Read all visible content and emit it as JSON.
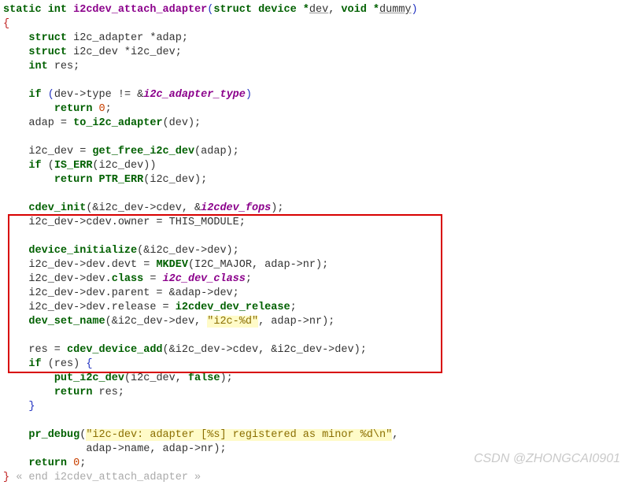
{
  "fn": {
    "ret": "static int",
    "name": "i2cdev_attach_adapter",
    "param1_type": "struct device *",
    "param1_name": "dev",
    "param2_type": "void *",
    "param2_name": "dummy"
  },
  "decl": {
    "l1a": "struct",
    "l1b": "i2c_adapter *adap;",
    "l2a": "struct",
    "l2b": "i2c_dev *i2c_dev;",
    "l3a": "int",
    "l3b": "res;"
  },
  "if1": {
    "kw": "if",
    "cond_l": "(dev->type != &",
    "type": "i2c_adapter_type",
    "cond_r": ")",
    "ret_kw": "return",
    "ret_v": "0",
    "semi": ";"
  },
  "adap": {
    "lhs": "adap = ",
    "fn": "to_i2c_adapter",
    "args": "(dev);"
  },
  "getdev": {
    "lhs": "i2c_dev = ",
    "fn": "get_free_i2c_dev",
    "args": "(adap);"
  },
  "if2": {
    "kw": "if",
    "open": " (",
    "fn": "IS_ERR",
    "args": "(i2c_dev))",
    "ret_kw": "return",
    "ret_fn": "PTR_ERR",
    "ret_args": "(i2c_dev);"
  },
  "box": {
    "l1_fn": "cdev_init",
    "l1_a": "(&i2c_dev->cdev, &",
    "l1_fops": "i2cdev_fops",
    "l1_r": ");",
    "l2": "i2c_dev->cdev.owner = THIS_MODULE;",
    "l3_fn": "device_initialize",
    "l3_args": "(&i2c_dev->dev);",
    "l4_a": "i2c_dev->dev.devt = ",
    "l4_fn": "MKDEV",
    "l4_b": "(I2C_MAJOR, adap->nr);",
    "l5_a": "i2c_dev->dev.",
    "l5_class_kw": "class",
    "l5_b": " = ",
    "l5_class": "i2c_dev_class",
    "l5_c": ";",
    "l6": "i2c_dev->dev.parent = &adap->dev;",
    "l7_a": "i2c_dev->dev.release = ",
    "l7_fn": "i2cdev_dev_release",
    "l7_b": ";",
    "l8_fn": "dev_set_name",
    "l8_a": "(&i2c_dev->dev, ",
    "l8_str": "\"i2c-%d\"",
    "l8_b": ", adap->nr);",
    "l9_a": "res = ",
    "l9_fn": "cdev_device_add",
    "l9_b": "(&i2c_dev->cdev, &i2c_dev->dev);"
  },
  "if3": {
    "kw": "if",
    "cond": " (res) ",
    "put_fn": "put_i2c_dev",
    "put_args": "(i2c_dev, ",
    "false_kw": "false",
    "put_close": ");",
    "ret_kw": "return",
    "ret_v": " res;"
  },
  "debug": {
    "fn": "pr_debug",
    "open": "(",
    "str": "\"i2c-dev: adapter [%s] registered as minor %d\\n\"",
    "args2": "adap->name, adap->nr);"
  },
  "ret0": {
    "kw": "return",
    "v": "0",
    "semi": ";"
  },
  "end_comment": " « end i2cdev_attach_adapter »",
  "watermark": "CSDN @ZHONGCAI0901"
}
